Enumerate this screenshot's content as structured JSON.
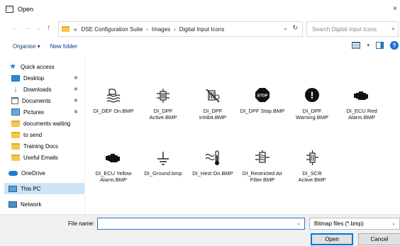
{
  "window": {
    "title": "Open",
    "close_glyph": "×"
  },
  "nav": {
    "back": "←",
    "forward": "→",
    "recent": "⌄",
    "up": "↑"
  },
  "address": {
    "overflow": "«",
    "crumbs": [
      "DSE Configuration Suite",
      "Images",
      "Digital Input Icons"
    ],
    "separator": "›",
    "dropdown": "⌄",
    "refresh": "↻"
  },
  "search": {
    "placeholder": "Search Digital Input Icons",
    "icon": "search-icon"
  },
  "toolbar": {
    "organise": "Organise ▾",
    "new_folder": "New folder",
    "help": "?"
  },
  "sidebar": {
    "items": [
      {
        "label": "Quick access",
        "icon": "star-icon"
      },
      {
        "label": "Desktop",
        "icon": "desktop-icon",
        "pinned": true
      },
      {
        "label": "Downloads",
        "icon": "download-icon",
        "pinned": true
      },
      {
        "label": "Documents",
        "icon": "documents-icon",
        "pinned": true
      },
      {
        "label": "Pictures",
        "icon": "pictures-icon",
        "pinned": true
      },
      {
        "label": "documents waiting",
        "icon": "folder-icon"
      },
      {
        "label": "to send",
        "icon": "folder-icon"
      },
      {
        "label": "Training Docs",
        "icon": "folder-icon"
      },
      {
        "label": "Useful Emails",
        "icon": "folder-icon"
      },
      {
        "label": "OneDrive",
        "icon": "cloud-icon"
      },
      {
        "label": "This PC",
        "icon": "computer-icon",
        "selected": true
      },
      {
        "label": "Network",
        "icon": "network-icon"
      }
    ],
    "pin_glyph": "✱"
  },
  "files": [
    {
      "name": "DI_DEF On.BMP",
      "icon": "def-fluid-icon"
    },
    {
      "name": "DI_DPF Active.BMP",
      "icon": "dpf-active-icon"
    },
    {
      "name": "DI_DPF Inhibit.BMP",
      "icon": "dpf-inhibit-icon"
    },
    {
      "name": "DI_DPF Stop.BMP",
      "icon": "stop-sign-icon",
      "glyph": "STOP"
    },
    {
      "name": "DI_DPF Warning.BMP",
      "icon": "warning-icon",
      "glyph": "!"
    },
    {
      "name": "DI_ECU Red Alarm.BMP",
      "icon": "engine-red-icon"
    },
    {
      "name": "DI_ECU Yellow Alarm.BMP",
      "icon": "engine-yellow-icon"
    },
    {
      "name": "DI_Ground.bmp",
      "icon": "ground-icon"
    },
    {
      "name": "DI_Hest On.BMP",
      "icon": "heater-icon"
    },
    {
      "name": "DI_Restricted Air Filter.BMP",
      "icon": "air-filter-icon"
    },
    {
      "name": "DI_SCR Active.BMP",
      "icon": "scr-active-icon"
    }
  ],
  "bottom": {
    "filename_label": "File name:",
    "filename_value": "",
    "filetype": "Bitmap files (*.bmp)",
    "caret": "⌄",
    "open_label": "Open",
    "cancel_label": "Cancel"
  }
}
